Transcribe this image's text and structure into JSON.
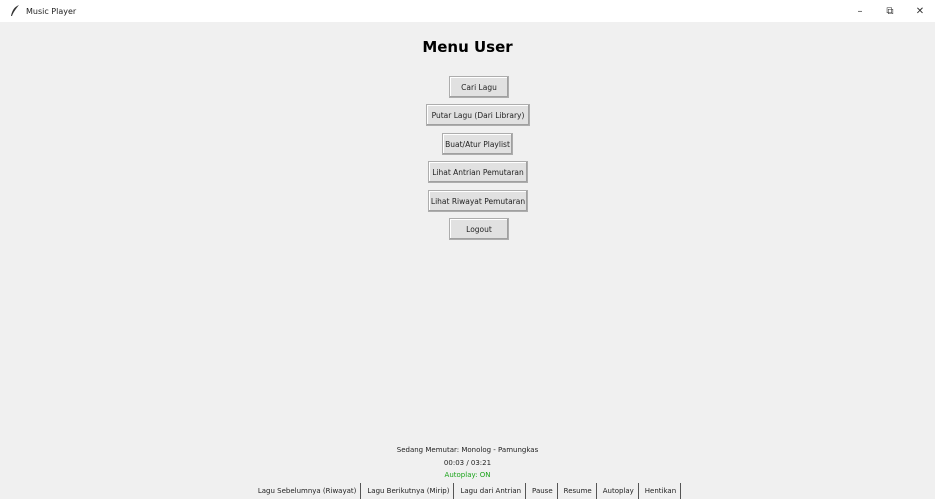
{
  "window": {
    "title": "Music Player",
    "app_icon": "feather-icon",
    "controls": {
      "minimize": "–",
      "maximize": "⧉",
      "close": "✕"
    }
  },
  "menu": {
    "title": "Menu User",
    "buttons": [
      {
        "id": "cari-lagu",
        "label": "Cari Lagu"
      },
      {
        "id": "putar-lagu",
        "label": "Putar Lagu (Dari Library)"
      },
      {
        "id": "buat-playlist",
        "label": "Buat/Atur Playlist"
      },
      {
        "id": "lihat-antrian",
        "label": "Lihat Antrian Pemutaran"
      },
      {
        "id": "lihat-riwayat",
        "label": "Lihat Riwayat Pemutaran"
      },
      {
        "id": "logout",
        "label": "Logout"
      }
    ]
  },
  "player": {
    "now_playing": "Sedang Memutar: Monolog - Pamungkas",
    "time": "00:03 / 03:21",
    "autoplay": "Autoplay: ON",
    "autoplay_color": "#1aa31a"
  },
  "controls": [
    {
      "id": "prev",
      "label": "Lagu Sebelumnya (Riwayat)"
    },
    {
      "id": "next",
      "label": "Lagu Berikutnya (Mirip)"
    },
    {
      "id": "queue",
      "label": "Lagu dari Antrian"
    },
    {
      "id": "pause",
      "label": "Pause"
    },
    {
      "id": "resume",
      "label": "Resume"
    },
    {
      "id": "autoplay",
      "label": "Autoplay"
    },
    {
      "id": "stop",
      "label": "Hentikan"
    }
  ]
}
